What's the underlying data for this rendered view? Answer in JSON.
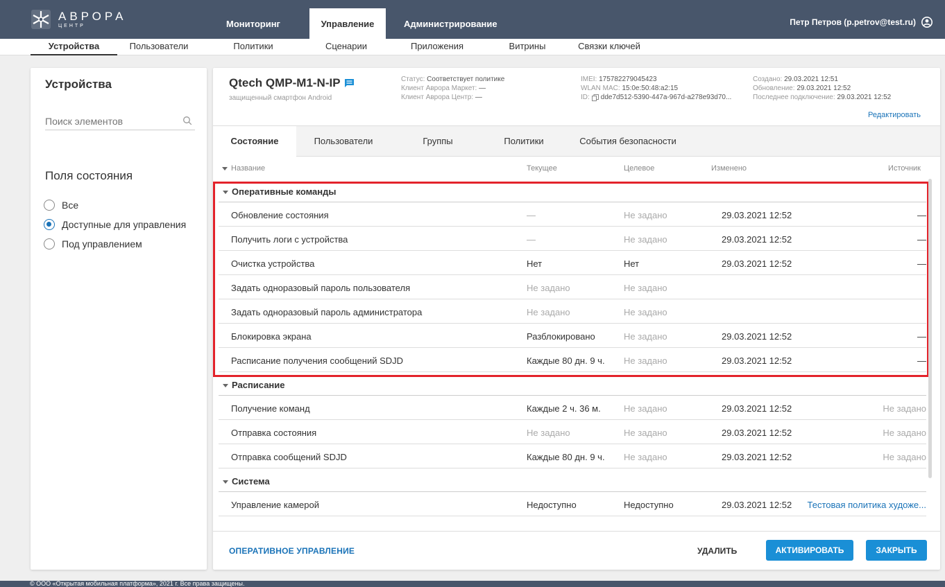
{
  "app": {
    "logo_text": "АВРОРА",
    "logo_subtext": "ЦЕНТР"
  },
  "main_nav": [
    {
      "label": "Мониторинг"
    },
    {
      "label": "Управление"
    },
    {
      "label": "Администрирование"
    }
  ],
  "user": {
    "label": "Петр Петров (p.petrov@test.ru)"
  },
  "sub_nav": [
    {
      "label": "Устройства"
    },
    {
      "label": "Пользователи"
    },
    {
      "label": "Политики"
    },
    {
      "label": "Сценарии"
    },
    {
      "label": "Приложения"
    },
    {
      "label": "Витрины"
    },
    {
      "label": "Связки ключей"
    }
  ],
  "sidebar": {
    "title": "Устройства",
    "search_placeholder": "Поиск элементов",
    "filter_title": "Поля состояния",
    "filters": [
      {
        "label": "Все",
        "checked": false
      },
      {
        "label": "Доступные для управления",
        "checked": true
      },
      {
        "label": "Под управлением",
        "checked": false
      }
    ]
  },
  "device": {
    "name": "Qtech QMP-M1-N-IP",
    "subtitle": "защищенный смартфон Android",
    "status_label": "Статус:",
    "status_value": "Соответствует политике",
    "market_label": "Клиент Аврора Маркет:",
    "market_value": "—",
    "center_label": "Клиент Аврора Центр:",
    "center_value": "—",
    "imei_label": "IMEI:",
    "imei_value": "175782279045423",
    "wlan_label": "WLAN MAC:",
    "wlan_value": "15:0e:50:48:a2:15",
    "id_label": "ID:",
    "id_value": "dde7d512-5390-447a-967d-a278e93d70...",
    "created_label": "Создано:",
    "created_value": "29.03.2021 12:51",
    "updated_label": "Обновление:",
    "updated_value": "29.03.2021 12:52",
    "last_conn_label": "Последнее подключение:",
    "last_conn_value": "29.03.2021 12:52",
    "edit_label": "Редактировать"
  },
  "tabs": [
    {
      "label": "Состояние"
    },
    {
      "label": "Пользователи"
    },
    {
      "label": "Группы"
    },
    {
      "label": "Политики"
    },
    {
      "label": "События безопасности"
    }
  ],
  "columns": {
    "name": "Название",
    "current": "Текущее",
    "target": "Целевое",
    "changed": "Изменено",
    "source": "Источник"
  },
  "groups": [
    {
      "label": "Оперативные команды",
      "rows": [
        {
          "name": "Обновление состояния",
          "current": "—",
          "target": "Не задано",
          "changed": "29.03.2021 12:52",
          "source": "—"
        },
        {
          "name": "Получить логи с устройства",
          "current": "—",
          "target": "Не задано",
          "changed": "29.03.2021 12:52",
          "source": "—"
        },
        {
          "name": "Очистка устройства",
          "current": "Нет",
          "target": "Нет",
          "changed": "29.03.2021 12:52",
          "source": "—"
        },
        {
          "name": "Задать одноразовый пароль пользователя",
          "current": "Не задано",
          "target": "Не задано",
          "changed": "",
          "source": ""
        },
        {
          "name": "Задать одноразовый пароль администратора",
          "current": "Не задано",
          "target": "Не задано",
          "changed": "",
          "source": ""
        },
        {
          "name": "Блокировка экрана",
          "current": "Разблокировано",
          "target": "Не задано",
          "changed": "29.03.2021 12:52",
          "source": "—"
        },
        {
          "name": "Расписание получения сообщений SDJD",
          "current": "Каждые 80 дн. 9 ч.",
          "target": "Не задано",
          "changed": "29.03.2021 12:52",
          "source": "—"
        }
      ]
    },
    {
      "label": "Расписание",
      "rows": [
        {
          "name": "Получение команд",
          "current": "Каждые 2 ч. 36 м.",
          "target": "Не задано",
          "changed": "29.03.2021 12:52",
          "source": "Не задано"
        },
        {
          "name": "Отправка состояния",
          "current": "Не задано",
          "target": "Не задано",
          "changed": "29.03.2021 12:52",
          "source": "Не задано"
        },
        {
          "name": "Отправка сообщений SDJD",
          "current": "Каждые 80 дн. 9 ч.",
          "target": "Не задано",
          "changed": "29.03.2021 12:52",
          "source": "Не задано"
        }
      ]
    },
    {
      "label": "Система",
      "rows": [
        {
          "name": "Управление камерой",
          "current": "Недоступно",
          "target": "Недоступно",
          "changed": "29.03.2021 12:52",
          "source": "Тестовая политика художе..."
        }
      ]
    }
  ],
  "footer": {
    "operative_label": "ОПЕРАТИВНОЕ УПРАВЛЕНИЕ",
    "delete_label": "УДАЛИТЬ",
    "activate_label": "АКТИВИРОВАТЬ",
    "close_label": "ЗАКРЫТЬ"
  },
  "copyright": "© ООО «Открытая мобильная платформа», 2021 г. Все права защищены.",
  "colors": {
    "topbar": "#48566b",
    "accent": "#1a73b8",
    "button": "#1a8fd6",
    "highlight": "#e3232b"
  }
}
